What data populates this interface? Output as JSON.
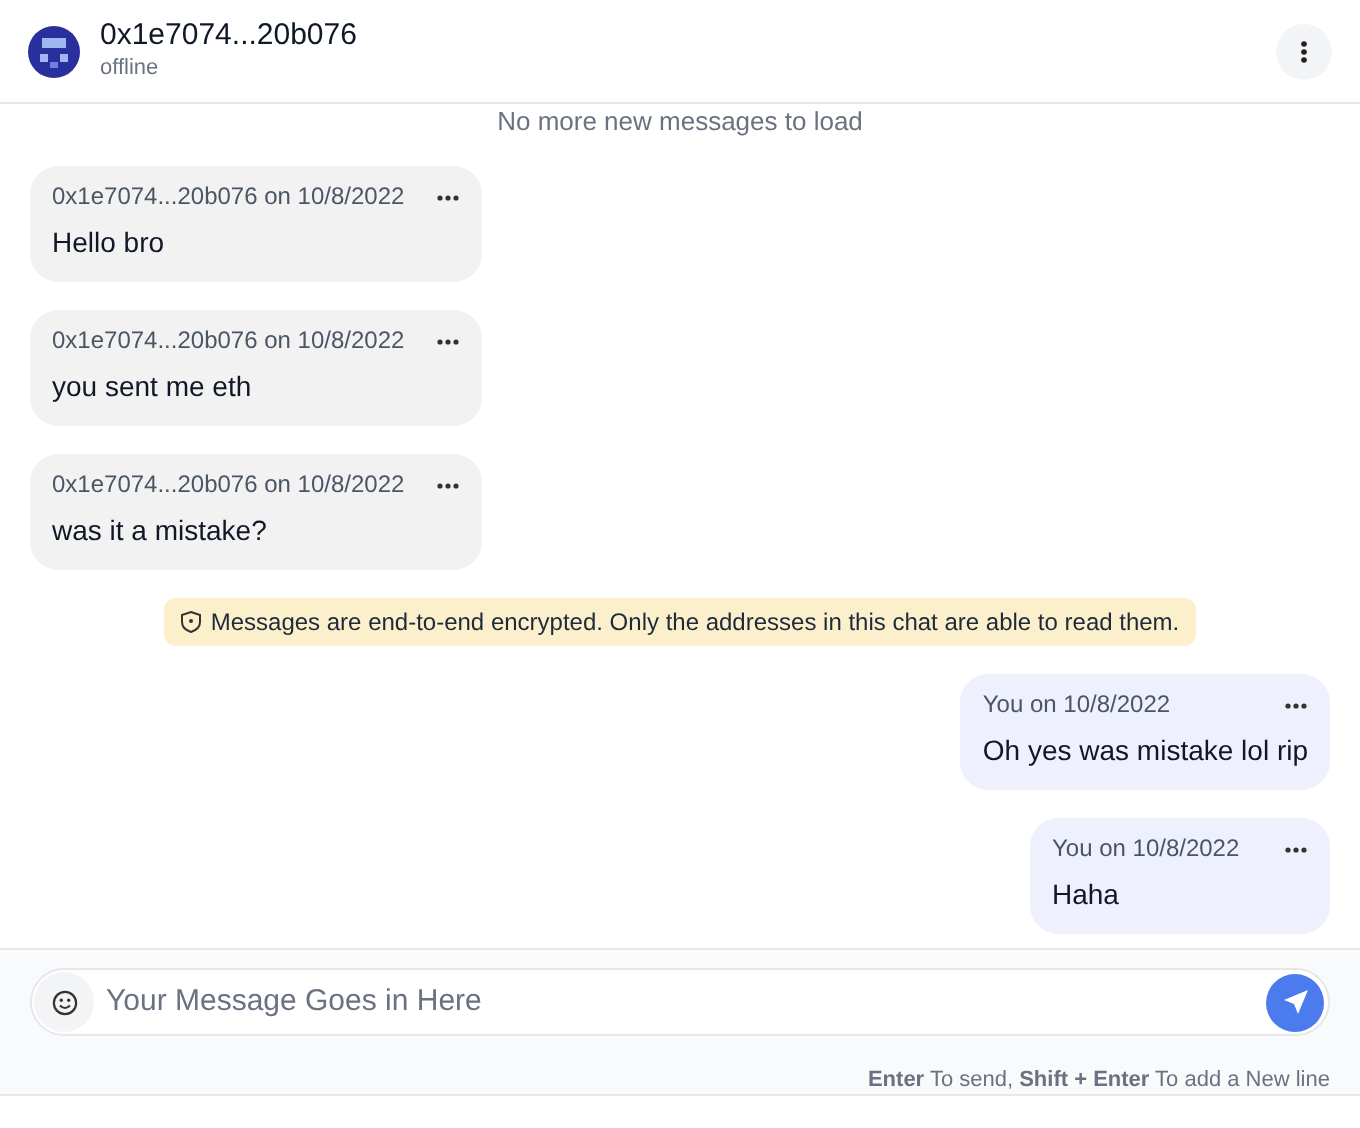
{
  "header": {
    "title": "0x1e7074...20b076",
    "status": "offline"
  },
  "load_notice": "No more new messages to load",
  "messages": [
    {
      "kind": "incoming",
      "sender": "0x1e7074...20b076 on 10/8/2022",
      "text": "Hello bro"
    },
    {
      "kind": "incoming",
      "sender": "0x1e7074...20b076 on 10/8/2022",
      "text": "you sent me eth"
    },
    {
      "kind": "incoming",
      "sender": "0x1e7074...20b076 on 10/8/2022",
      "text": "was it a mistake?"
    },
    {
      "kind": "notice",
      "text": "Messages are end-to-end encrypted. Only the addresses in this chat are able to read them."
    },
    {
      "kind": "outgoing",
      "sender": "You on 10/8/2022",
      "text": "Oh yes was mistake lol rip"
    },
    {
      "kind": "outgoing",
      "sender": "You on 10/8/2022",
      "text": "Haha"
    }
  ],
  "composer": {
    "placeholder": "Your Message Goes in Here",
    "hint": "**Enter** To send, **Shift + Enter** To add a New line"
  }
}
